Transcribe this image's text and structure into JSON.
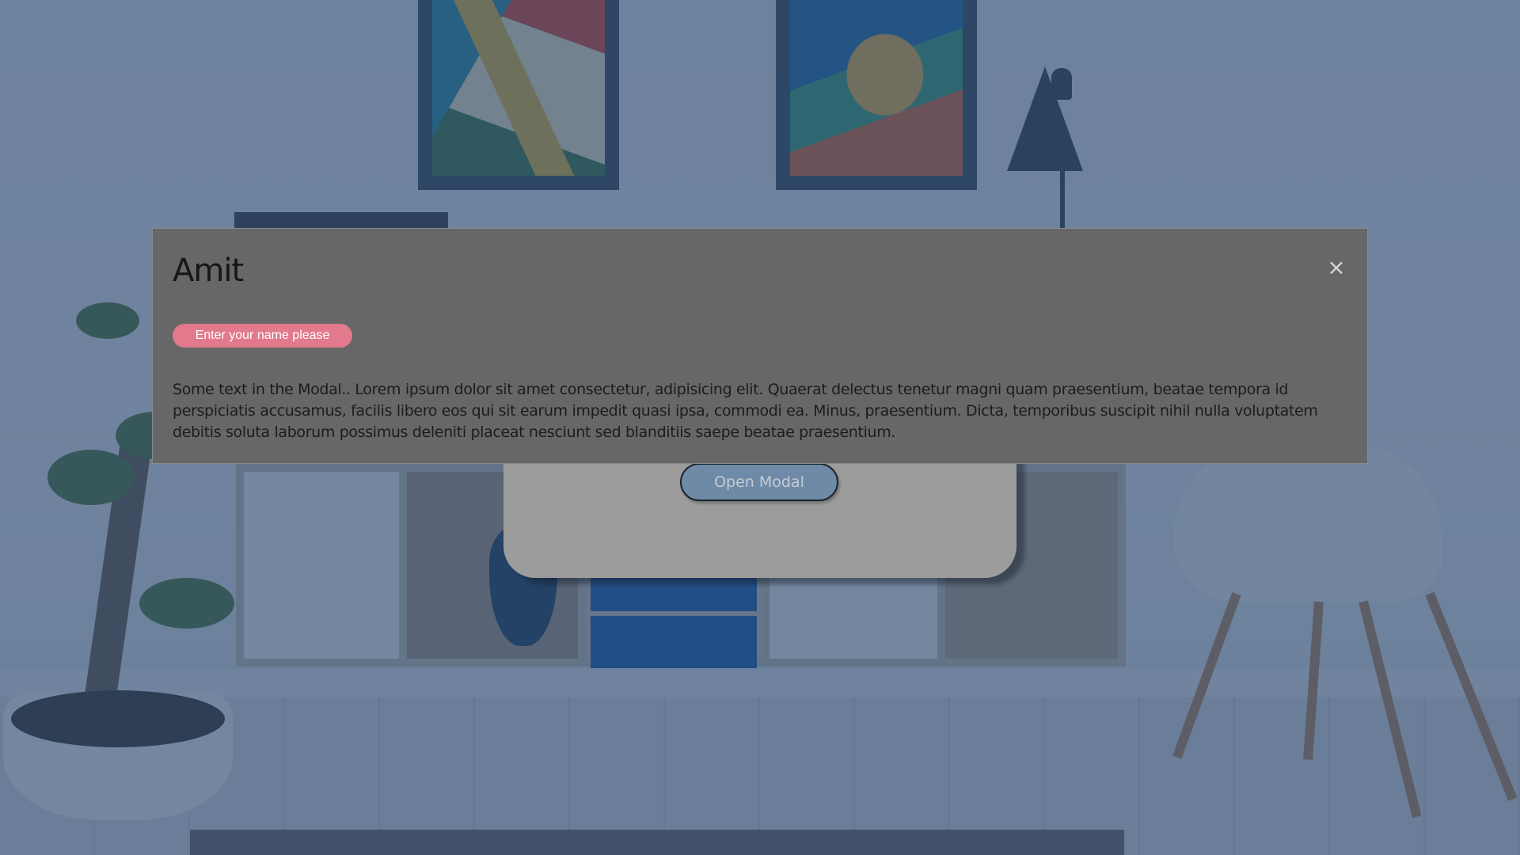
{
  "modal": {
    "title": "Amit",
    "close_label": "×",
    "name_prompt": "Enter your name please",
    "body_text": "Some text in the Modal.. Lorem ipsum dolor sit amet consectetur, adipisicing elit. Quaerat delectus tenetur magni quam praesentium, beatae tempora id perspiciatis accusamus, facilis libero eos qui sit earum impedit quasi ipsa, commodi ea. Minus, praesentium. Dicta, temporibus suscipit nihil nulla voluptatem debitis soluta laborum possimus deleniti placeat nesciunt sed blanditiis saepe beatae praesentium."
  },
  "card": {
    "open_button_label": "Open Modal"
  },
  "icons": {
    "close": "close-icon"
  },
  "colors": {
    "overlay": "#26446c",
    "modal_background": "#676767",
    "pill_background": "#e3798c",
    "open_button_background": "#6e8aa6",
    "card_background": "#9c9c9c"
  }
}
